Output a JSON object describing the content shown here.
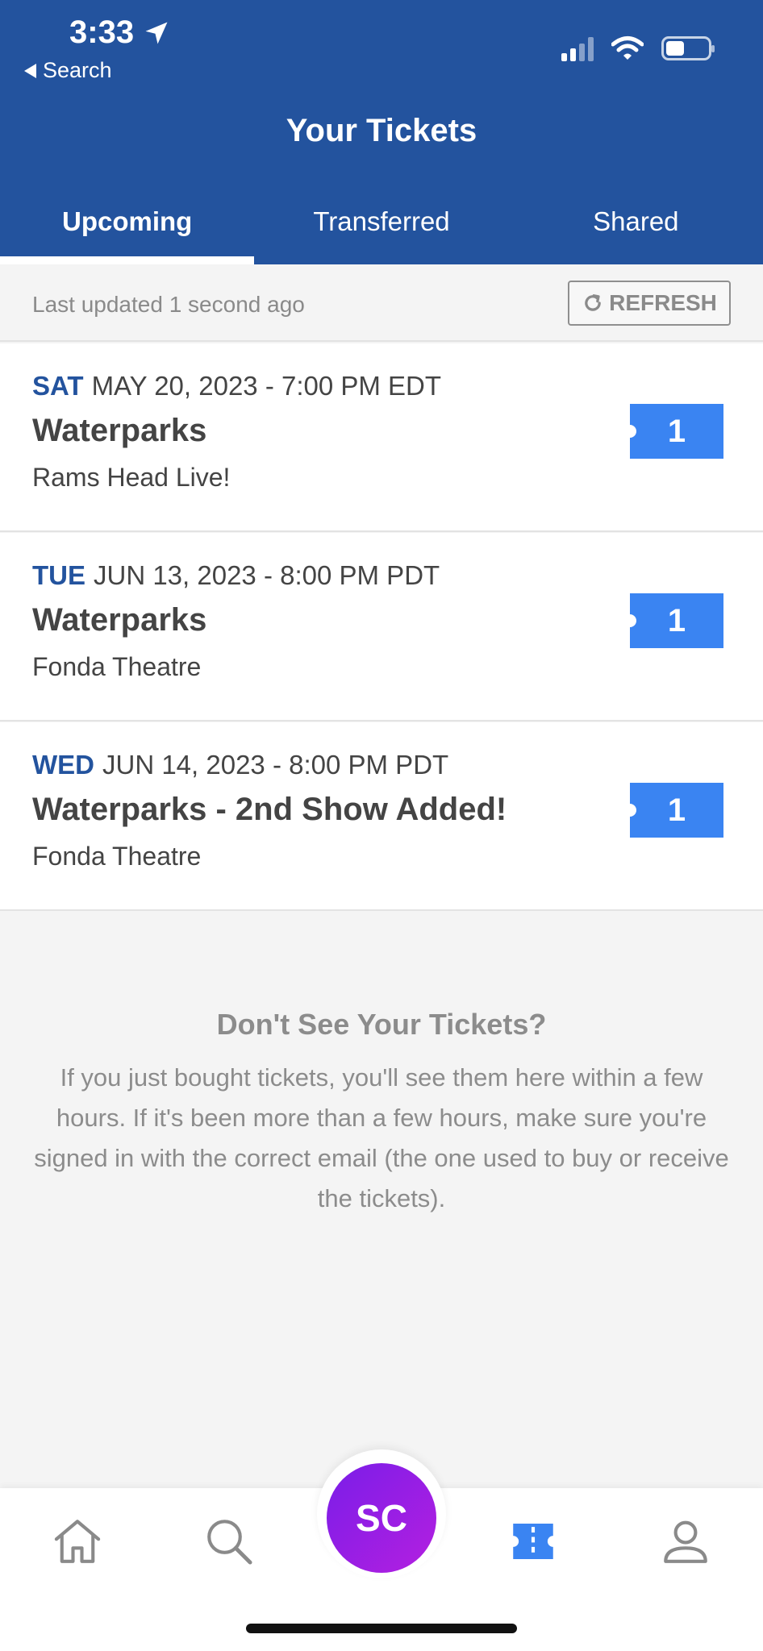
{
  "status_bar": {
    "time": "3:33",
    "back_label": "Search"
  },
  "header": {
    "title": "Your Tickets"
  },
  "tabs": [
    {
      "label": "Upcoming",
      "active": true
    },
    {
      "label": "Transferred",
      "active": false
    },
    {
      "label": "Shared",
      "active": false
    }
  ],
  "update_bar": {
    "text": "Last updated 1 second ago",
    "refresh_label": "REFRESH"
  },
  "events": [
    {
      "day": "SAT",
      "date": "MAY 20, 2023 - 7:00 PM EDT",
      "name": "Waterparks",
      "venue": "Rams Head Live!",
      "tickets": "1"
    },
    {
      "day": "TUE",
      "date": "JUN 13, 2023 - 8:00 PM PDT",
      "name": "Waterparks",
      "venue": "Fonda Theatre",
      "tickets": "1"
    },
    {
      "day": "WED",
      "date": "JUN 14, 2023 - 8:00 PM PDT",
      "name": "Waterparks - 2nd Show Added!",
      "venue": "Fonda Theatre",
      "tickets": "1"
    }
  ],
  "help": {
    "title": "Don't See Your Tickets?",
    "text": "If you just bought tickets, you'll see them here within a few hours. If it's been more than a few hours, make sure you're signed in with the correct email (the one used to buy or receive the tickets)."
  },
  "bottom_nav": {
    "items": [
      "home-icon",
      "search-icon",
      "profile-initials-button",
      "tickets-icon",
      "account-icon"
    ],
    "initials": "SC"
  },
  "colors": {
    "brand_blue": "#23539e",
    "badge_blue": "#3a84f2",
    "fab_purple": "#9a1fe4"
  }
}
